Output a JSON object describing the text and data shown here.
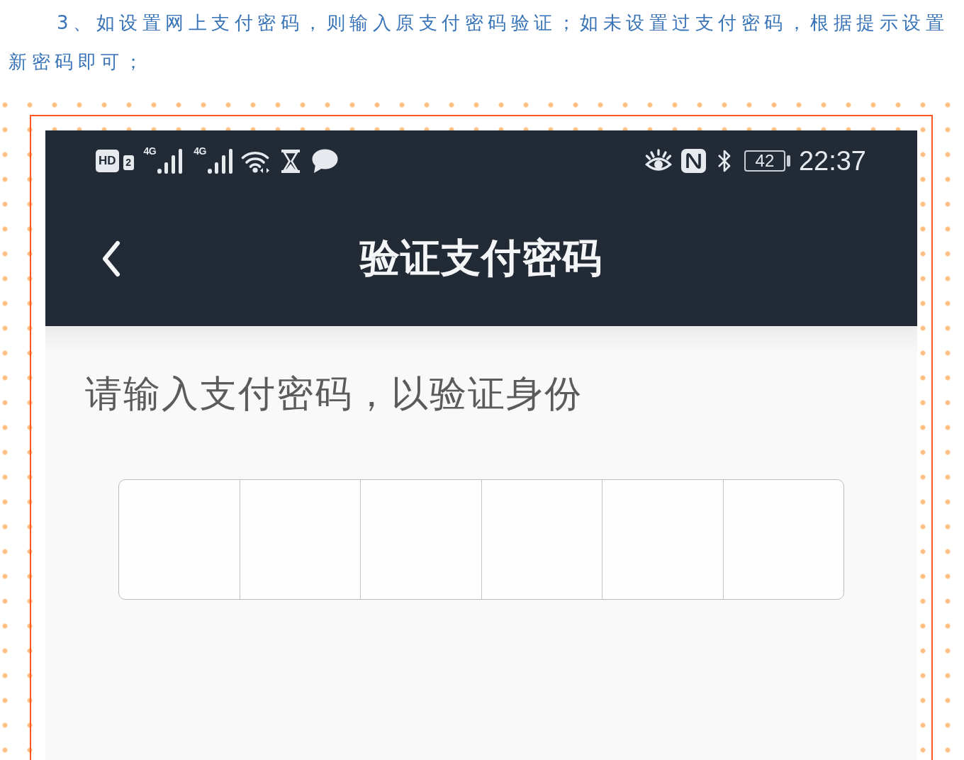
{
  "instruction": "3、如设置网上支付密码，则输入原支付密码验证；如未设置过支付密码，根据提示设置新密码即可；",
  "status_bar": {
    "hd_badge": "HD",
    "sim_slot": "2",
    "networks": [
      {
        "type": "4G"
      },
      {
        "type": "4G"
      }
    ],
    "battery": "42",
    "time": "22:37"
  },
  "nav_bar": {
    "title": "验证支付密码"
  },
  "prompt": "请输入支付密码，以验证身份",
  "password_field": {
    "cells": [
      {
        "filled": false
      },
      {
        "filled": false
      },
      {
        "filled": false
      },
      {
        "filled": false
      },
      {
        "filled": false
      },
      {
        "filled": false
      }
    ]
  }
}
